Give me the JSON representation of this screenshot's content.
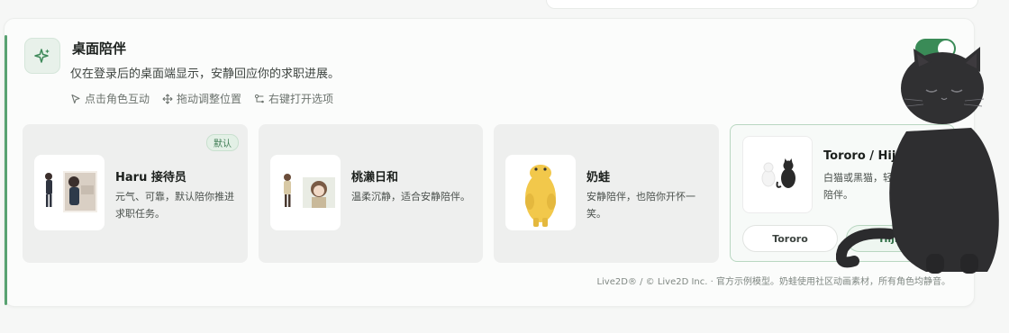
{
  "feature": {
    "title": "桌面陪伴",
    "description": "仅在登录后的桌面端显示，安静回应你的求职进展。",
    "enabled": true,
    "icon": "sparkle-icon",
    "hints": [
      {
        "icon": "cursor-icon",
        "label": "点击角色互动"
      },
      {
        "icon": "move-icon",
        "label": "拖动调整位置"
      },
      {
        "icon": "right-click-icon",
        "label": "右键打开选项"
      }
    ]
  },
  "characters": [
    {
      "name": "Haru 接待员",
      "description": "元气、可靠，默认陪你推进求职任务。",
      "badge": "默认"
    },
    {
      "name": "桃濑日和",
      "description": "温柔沉静，适合安静陪伴。"
    },
    {
      "name": "奶蛙",
      "description": "安静陪伴，也陪你开怀一笑。"
    },
    {
      "name": "Tororo / Hijiki",
      "description": "白猫或黑猫，轻松治愈陪伴。",
      "variants": [
        "Tororo",
        "Hijiki"
      ],
      "active_variant": "Hijiki"
    }
  ],
  "credit": "Live2D® / © Live2D Inc. · 官方示例模型。奶蛙使用社区动画素材，所有角色均静音。",
  "colors": {
    "accent": "#3a8b57",
    "accent_light": "#e8f1ea"
  }
}
